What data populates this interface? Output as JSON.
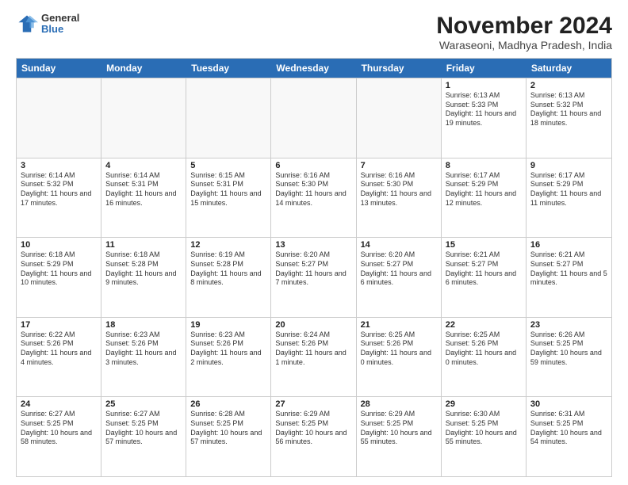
{
  "logo": {
    "general": "General",
    "blue": "Blue"
  },
  "title": {
    "month": "November 2024",
    "location": "Waraseoni, Madhya Pradesh, India"
  },
  "header_days": [
    "Sunday",
    "Monday",
    "Tuesday",
    "Wednesday",
    "Thursday",
    "Friday",
    "Saturday"
  ],
  "rows": [
    [
      {
        "day": "",
        "info": "",
        "empty": true
      },
      {
        "day": "",
        "info": "",
        "empty": true
      },
      {
        "day": "",
        "info": "",
        "empty": true
      },
      {
        "day": "",
        "info": "",
        "empty": true
      },
      {
        "day": "",
        "info": "",
        "empty": true
      },
      {
        "day": "1",
        "info": "Sunrise: 6:13 AM\nSunset: 5:33 PM\nDaylight: 11 hours and 19 minutes.",
        "empty": false
      },
      {
        "day": "2",
        "info": "Sunrise: 6:13 AM\nSunset: 5:32 PM\nDaylight: 11 hours and 18 minutes.",
        "empty": false
      }
    ],
    [
      {
        "day": "3",
        "info": "Sunrise: 6:14 AM\nSunset: 5:32 PM\nDaylight: 11 hours and 17 minutes.",
        "empty": false
      },
      {
        "day": "4",
        "info": "Sunrise: 6:14 AM\nSunset: 5:31 PM\nDaylight: 11 hours and 16 minutes.",
        "empty": false
      },
      {
        "day": "5",
        "info": "Sunrise: 6:15 AM\nSunset: 5:31 PM\nDaylight: 11 hours and 15 minutes.",
        "empty": false
      },
      {
        "day": "6",
        "info": "Sunrise: 6:16 AM\nSunset: 5:30 PM\nDaylight: 11 hours and 14 minutes.",
        "empty": false
      },
      {
        "day": "7",
        "info": "Sunrise: 6:16 AM\nSunset: 5:30 PM\nDaylight: 11 hours and 13 minutes.",
        "empty": false
      },
      {
        "day": "8",
        "info": "Sunrise: 6:17 AM\nSunset: 5:29 PM\nDaylight: 11 hours and 12 minutes.",
        "empty": false
      },
      {
        "day": "9",
        "info": "Sunrise: 6:17 AM\nSunset: 5:29 PM\nDaylight: 11 hours and 11 minutes.",
        "empty": false
      }
    ],
    [
      {
        "day": "10",
        "info": "Sunrise: 6:18 AM\nSunset: 5:29 PM\nDaylight: 11 hours and 10 minutes.",
        "empty": false
      },
      {
        "day": "11",
        "info": "Sunrise: 6:18 AM\nSunset: 5:28 PM\nDaylight: 11 hours and 9 minutes.",
        "empty": false
      },
      {
        "day": "12",
        "info": "Sunrise: 6:19 AM\nSunset: 5:28 PM\nDaylight: 11 hours and 8 minutes.",
        "empty": false
      },
      {
        "day": "13",
        "info": "Sunrise: 6:20 AM\nSunset: 5:27 PM\nDaylight: 11 hours and 7 minutes.",
        "empty": false
      },
      {
        "day": "14",
        "info": "Sunrise: 6:20 AM\nSunset: 5:27 PM\nDaylight: 11 hours and 6 minutes.",
        "empty": false
      },
      {
        "day": "15",
        "info": "Sunrise: 6:21 AM\nSunset: 5:27 PM\nDaylight: 11 hours and 6 minutes.",
        "empty": false
      },
      {
        "day": "16",
        "info": "Sunrise: 6:21 AM\nSunset: 5:27 PM\nDaylight: 11 hours and 5 minutes.",
        "empty": false
      }
    ],
    [
      {
        "day": "17",
        "info": "Sunrise: 6:22 AM\nSunset: 5:26 PM\nDaylight: 11 hours and 4 minutes.",
        "empty": false
      },
      {
        "day": "18",
        "info": "Sunrise: 6:23 AM\nSunset: 5:26 PM\nDaylight: 11 hours and 3 minutes.",
        "empty": false
      },
      {
        "day": "19",
        "info": "Sunrise: 6:23 AM\nSunset: 5:26 PM\nDaylight: 11 hours and 2 minutes.",
        "empty": false
      },
      {
        "day": "20",
        "info": "Sunrise: 6:24 AM\nSunset: 5:26 PM\nDaylight: 11 hours and 1 minute.",
        "empty": false
      },
      {
        "day": "21",
        "info": "Sunrise: 6:25 AM\nSunset: 5:26 PM\nDaylight: 11 hours and 0 minutes.",
        "empty": false
      },
      {
        "day": "22",
        "info": "Sunrise: 6:25 AM\nSunset: 5:26 PM\nDaylight: 11 hours and 0 minutes.",
        "empty": false
      },
      {
        "day": "23",
        "info": "Sunrise: 6:26 AM\nSunset: 5:25 PM\nDaylight: 10 hours and 59 minutes.",
        "empty": false
      }
    ],
    [
      {
        "day": "24",
        "info": "Sunrise: 6:27 AM\nSunset: 5:25 PM\nDaylight: 10 hours and 58 minutes.",
        "empty": false
      },
      {
        "day": "25",
        "info": "Sunrise: 6:27 AM\nSunset: 5:25 PM\nDaylight: 10 hours and 57 minutes.",
        "empty": false
      },
      {
        "day": "26",
        "info": "Sunrise: 6:28 AM\nSunset: 5:25 PM\nDaylight: 10 hours and 57 minutes.",
        "empty": false
      },
      {
        "day": "27",
        "info": "Sunrise: 6:29 AM\nSunset: 5:25 PM\nDaylight: 10 hours and 56 minutes.",
        "empty": false
      },
      {
        "day": "28",
        "info": "Sunrise: 6:29 AM\nSunset: 5:25 PM\nDaylight: 10 hours and 55 minutes.",
        "empty": false
      },
      {
        "day": "29",
        "info": "Sunrise: 6:30 AM\nSunset: 5:25 PM\nDaylight: 10 hours and 55 minutes.",
        "empty": false
      },
      {
        "day": "30",
        "info": "Sunrise: 6:31 AM\nSunset: 5:25 PM\nDaylight: 10 hours and 54 minutes.",
        "empty": false
      }
    ]
  ]
}
